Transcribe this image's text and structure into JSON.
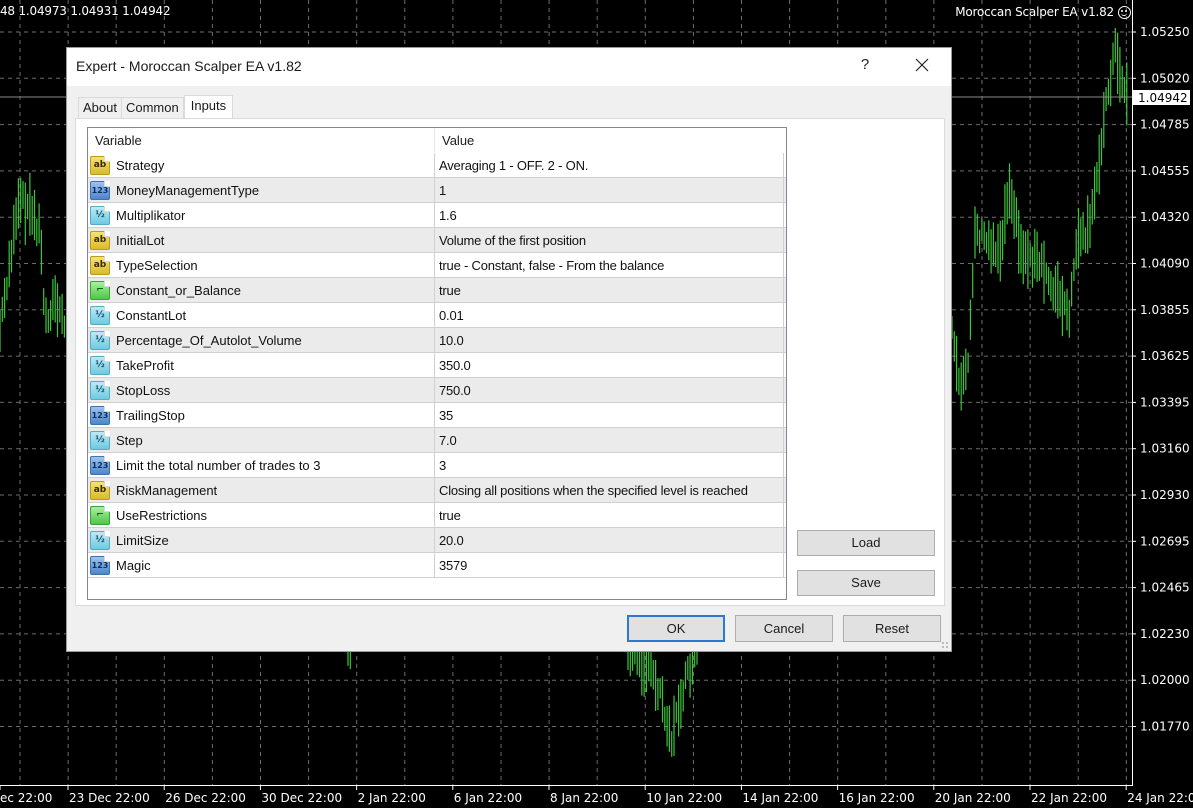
{
  "chart": {
    "ohlc_text": "48 1.04973 1.04931 1.04942",
    "ea_name": "Moroccan Scalper EA v1.82",
    "ea_status_icon": "smiley-icon",
    "current_price": "1.04942",
    "bar_color": "#3ec43a",
    "price_axis": [
      "1.05250",
      "1.05020",
      "1.04785",
      "1.04555",
      "1.04320",
      "1.04090",
      "1.03855",
      "1.03625",
      "1.03395",
      "1.03160",
      "1.02930",
      "1.02695",
      "1.02465",
      "1.02230",
      "1.02000",
      "1.01770"
    ],
    "time_axis": [
      "ec 22:00",
      "23 Dec 22:00",
      "26 Dec 22:00",
      "30 Dec 22:00",
      "2 Jan 22:00",
      "6 Jan 22:00",
      "8 Jan 22:00",
      "10 Jan 22:00",
      "14 Jan 22:00",
      "16 Jan 22:00",
      "20 Jan 22:00",
      "22 Jan 22:00",
      "24 Jan 22:00"
    ]
  },
  "dialog": {
    "title": "Expert - Moroccan Scalper EA v1.82",
    "help_label": "?",
    "tabs": [
      {
        "label": "About",
        "active": false
      },
      {
        "label": "Common",
        "active": false
      },
      {
        "label": "Inputs",
        "active": true
      }
    ],
    "table": {
      "columns": [
        "Variable",
        "Value"
      ],
      "rows": [
        {
          "type": "string",
          "variable": "Strategy",
          "value": "Averaging 1 - OFF. 2 - ON."
        },
        {
          "type": "int",
          "variable": "MoneyManagementType",
          "value": "1"
        },
        {
          "type": "double",
          "variable": "Multiplikator",
          "value": "1.6"
        },
        {
          "type": "string",
          "variable": "InitialLot",
          "value": "Volume of the first position"
        },
        {
          "type": "string",
          "variable": "TypeSelection",
          "value": "true - Constant, false - From the balance"
        },
        {
          "type": "bool",
          "variable": "Constant_or_Balance",
          "value": "true"
        },
        {
          "type": "double",
          "variable": "ConstantLot",
          "value": "0.01"
        },
        {
          "type": "double",
          "variable": "Percentage_Of_Autolot_Volume",
          "value": "10.0"
        },
        {
          "type": "double",
          "variable": "TakeProfit",
          "value": "350.0"
        },
        {
          "type": "double",
          "variable": "StopLoss",
          "value": "750.0"
        },
        {
          "type": "int",
          "variable": "TrailingStop",
          "value": "35"
        },
        {
          "type": "double",
          "variable": "Step",
          "value": "7.0"
        },
        {
          "type": "int",
          "variable": "Limit the total number of trades to 3",
          "value": "3"
        },
        {
          "type": "string",
          "variable": "RiskManagement",
          "value": "Closing all positions when the specified level is reached"
        },
        {
          "type": "bool",
          "variable": "UseRestrictions",
          "value": "true"
        },
        {
          "type": "double",
          "variable": "LimitSize",
          "value": "20.0"
        },
        {
          "type": "int",
          "variable": "Magic",
          "value": "3579"
        }
      ]
    },
    "type_icons": {
      "string": {
        "glyph": "ab",
        "name": "string-type-icon"
      },
      "int": {
        "glyph": "123",
        "name": "integer-type-icon"
      },
      "double": {
        "glyph": "½",
        "name": "double-type-icon"
      },
      "bool": {
        "glyph": "⌐",
        "name": "bool-type-icon"
      }
    },
    "buttons": {
      "load": "Load",
      "save": "Save",
      "ok": "OK",
      "cancel": "Cancel",
      "reset": "Reset"
    }
  }
}
